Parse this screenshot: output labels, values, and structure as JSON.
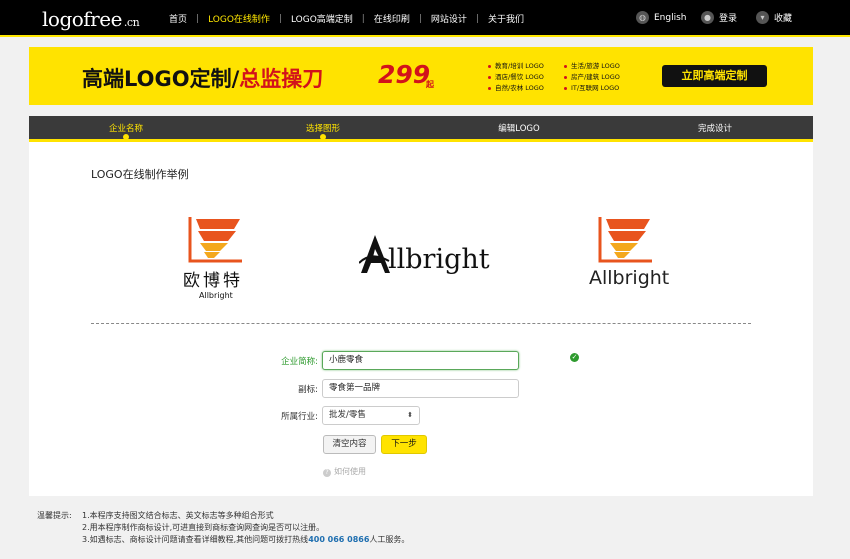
{
  "header": {
    "logo": "logofree",
    "logo_suffix": ".cn",
    "nav": [
      "首页",
      "LOGO在线制作",
      "LOGO高端定制",
      "在线印刷",
      "网站设计",
      "关于我们"
    ],
    "active_nav": 1,
    "language": "English",
    "login": "登录",
    "favorite": "收藏"
  },
  "banner": {
    "title_black": "高端LOGO定制/",
    "title_red": "总监操刀",
    "price": "299",
    "price_suffix": "起",
    "list_col1": [
      "教育/培训 LOGO",
      "酒店/餐饮 LOGO",
      "自然/农林 LOGO"
    ],
    "list_col2": [
      "生活/旅游 LOGO",
      "房产/建筑 LOGO",
      "IT/互联网 LOGO"
    ],
    "cta": "立即高端定制"
  },
  "steps": [
    "企业名称",
    "选择图形",
    "编辑LOGO",
    "完成设计"
  ],
  "section_title": "LOGO在线制作举例",
  "examples": {
    "ex1_cn": "欧博特",
    "ex1_en": "Allbright",
    "ex2_en": "llbright",
    "ex3_en": "Allbright"
  },
  "form": {
    "company_label": "企业简称:",
    "company_value": "小鹿零食",
    "subtitle_label": "副标:",
    "subtitle_value": "零食第一品牌",
    "industry_label": "所属行业:",
    "industry_value": "批发/零售",
    "clear_button": "清空内容",
    "next_button": "下一步",
    "help": "如何使用"
  },
  "tips": {
    "label": "温馨提示:",
    "line1": "1.本程序支持图文结合标志、英文标志等多种组合形式",
    "line2": "2.用本程序制作商标设计,可进直接到商标查询网查询是否可以注册。",
    "line3_pre": "3.如遇标志、商标设计问题请查看详细教程,其他问题可拨打热线",
    "hotline": "400 066 0866",
    "line3_post": "人工服务。"
  },
  "colors": {
    "accent": "#ffe300",
    "brand_red": "#d2121b",
    "logo_orange": "#e8541e",
    "success": "#2e9a2e"
  }
}
